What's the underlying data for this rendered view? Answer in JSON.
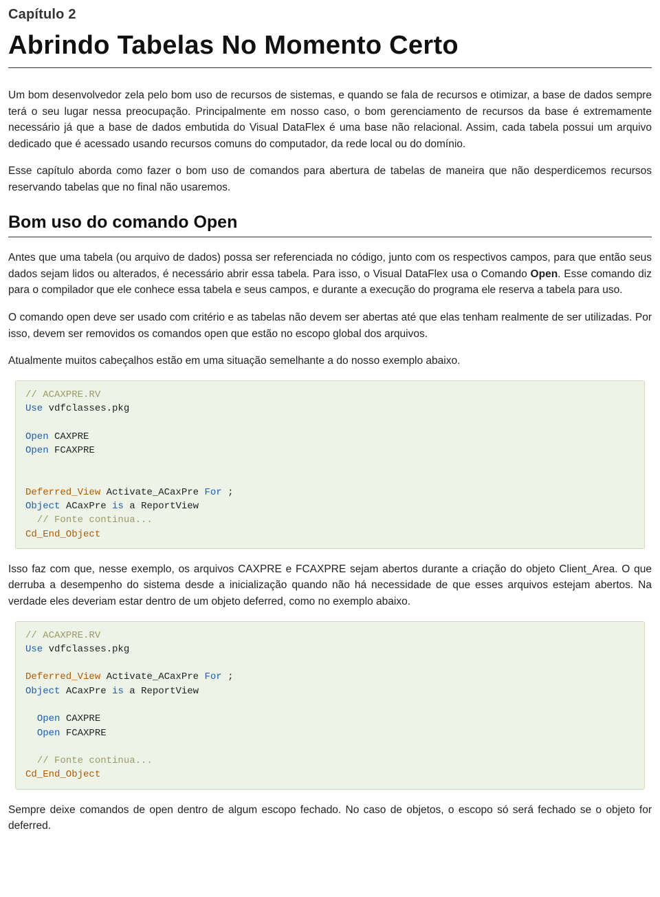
{
  "chapter_label": "Capítulo 2",
  "title": "Abrindo Tabelas No Momento Certo",
  "paragraphs": {
    "p1": "Um bom desenvolvedor zela pelo bom uso de recursos de sistemas, e quando se fala de recursos e otimizar, a base de dados sempre terá o seu lugar nessa preocupação. Principalmente em nosso caso, o bom gerenciamento de recursos da base é extremamente necessário já que a base de dados embutida do Visual DataFlex é uma base não relacional. Assim, cada tabela possui um arquivo dedicado que é acessado usando recursos comuns do computador, da rede local ou do domínio.",
    "p2": "Esse capítulo aborda como fazer o bom uso de comandos para abertura de tabelas de maneira que não desperdicemos recursos reservando tabelas que no final não usaremos."
  },
  "section_heading": "Bom uso do comando Open",
  "section": {
    "p1a": "Antes que uma tabela (ou arquivo de dados) possa ser referenciada no código, junto com os respectivos campos, para que então seus dados sejam lidos ou alterados, é necessário abrir essa tabela. Para isso, o Visual DataFlex usa o Comando ",
    "p1b": "Open",
    "p1c": ". Esse comando diz para o compilador que ele conhece essa tabela e seus campos, e durante a execução do programa ele reserva a tabela para uso.",
    "p2": "O comando open deve ser usado com critério e as tabelas não devem ser abertas até que elas tenham realmente de ser utilizadas. Por isso, devem ser removidos os comandos open que estão no escopo global dos arquivos.",
    "p3": "Atualmente muitos cabeçalhos estão em uma situação semelhante a do nosso exemplo abaixo.",
    "p4": "Isso faz com que, nesse exemplo, os arquivos CAXPRE e FCAXPRE sejam abertos durante a criação do objeto Client_Area. O que derruba a desempenho do sistema desde a inicialização quando não há necessidade de que esses arquivos estejam abertos. Na verdade eles deveriam estar dentro de um objeto deferred, como no exemplo abaixo.",
    "p5": "Sempre deixe comandos de open dentro de algum escopo fechado. No caso de objetos, o escopo só será fechado se o objeto for deferred."
  },
  "code1": {
    "c_comment1": "// ACAXPRE.RV",
    "c_use": "Use",
    "c_use_arg": " vdfclasses.pkg",
    "c_open1": "Open",
    "c_open1_arg": " CAXPRE",
    "c_open2": "Open",
    "c_open2_arg": " FCAXPRE",
    "c_defview": "Deferred_View",
    "c_defview_arg": " Activate_ACaxPre ",
    "c_for": "For",
    "c_for_suffix": " ;",
    "c_object": "Object",
    "c_object_arg": " ACaxPre ",
    "c_is": "is",
    "c_is_arg": " a ReportView",
    "c_comment2": "  // Fonte continua...",
    "c_end": "Cd_End_Object"
  },
  "code2": {
    "c_comment1": "// ACAXPRE.RV",
    "c_use": "Use",
    "c_use_arg": " vdfclasses.pkg",
    "c_defview": "Deferred_View",
    "c_defview_arg": " Activate_ACaxPre ",
    "c_for": "For",
    "c_for_suffix": " ;",
    "c_object": "Object",
    "c_object_arg": " ACaxPre ",
    "c_is": "is",
    "c_is_arg": " a ReportView",
    "c_open1_indent": "  ",
    "c_open1": "Open",
    "c_open1_arg": " CAXPRE",
    "c_open2_indent": "  ",
    "c_open2": "Open",
    "c_open2_arg": " FCAXPRE",
    "c_comment2": "  // Fonte continua...",
    "c_end": "Cd_End_Object"
  }
}
